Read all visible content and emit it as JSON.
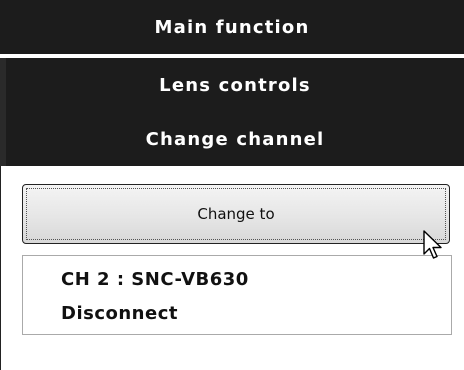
{
  "menu": {
    "main_function": "Main function",
    "lens_controls": "Lens controls",
    "change_channel": "Change channel"
  },
  "panel": {
    "change_to_label": "Change to",
    "channels": [
      {
        "label": "CH 2 : SNC-VB630"
      },
      {
        "label": "Disconnect"
      }
    ]
  },
  "colors": {
    "menu_background": "#1c1c1c",
    "menu_text": "#ffffff",
    "button_background": "#e6e6e6"
  },
  "icons": {
    "cursor": "mouse-pointer-icon"
  }
}
